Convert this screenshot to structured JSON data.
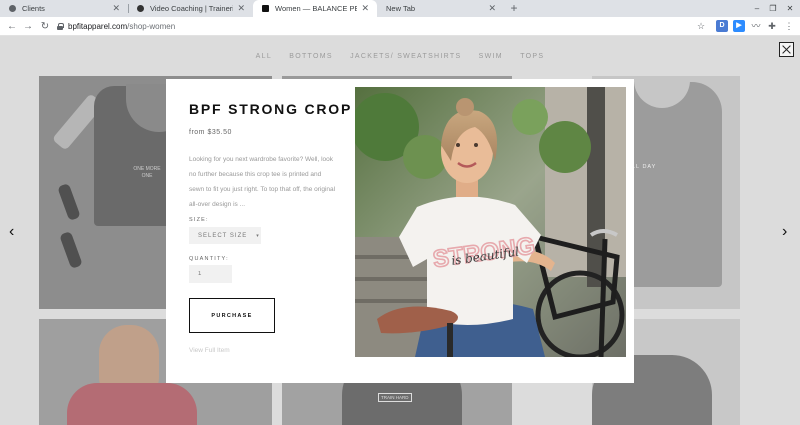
{
  "browser": {
    "tabs": [
      {
        "title": "Clients",
        "active": false
      },
      {
        "title": "Video Coaching | Trainerize Pers",
        "active": false
      },
      {
        "title": "Women — BALANCE PERFORMA",
        "active": true
      },
      {
        "title": "New Tab",
        "active": false
      }
    ],
    "new_tab_icon": "plus-icon",
    "url_host": "bpfitapparel.com",
    "url_path": "/shop-women",
    "extension_d_label": "D",
    "accent_color": "#4a7bd3"
  },
  "page": {
    "categories": [
      "ALL",
      "BOTTOMS",
      "JACKETS/ SWEATSHIRTS",
      "SWIM",
      "TOPS"
    ],
    "bg_card_texts": {
      "tank_logo": "ONE MORE ONE",
      "sleeveless_logo": "LL DAY",
      "hoodie_logo": "TRAIN HARD"
    },
    "prev_arrow": "‹",
    "next_arrow": "›"
  },
  "product": {
    "title": "BPF STRONG CROP",
    "price": "from $35.50",
    "description": "Looking for you next wardrobe favorite? Well, look no further because this crop tee is printed and sewn to fit you just right. To top that off, the original all-over design is ...",
    "size_label": "SIZE:",
    "size_placeholder": "SELECT SIZE",
    "quantity_label": "QUANTITY:",
    "quantity_value": "1",
    "purchase_label": "PURCHASE",
    "view_full_label": "View Full Item",
    "shirt_print_main": "STRONG",
    "shirt_print_script": "is beautiful"
  }
}
